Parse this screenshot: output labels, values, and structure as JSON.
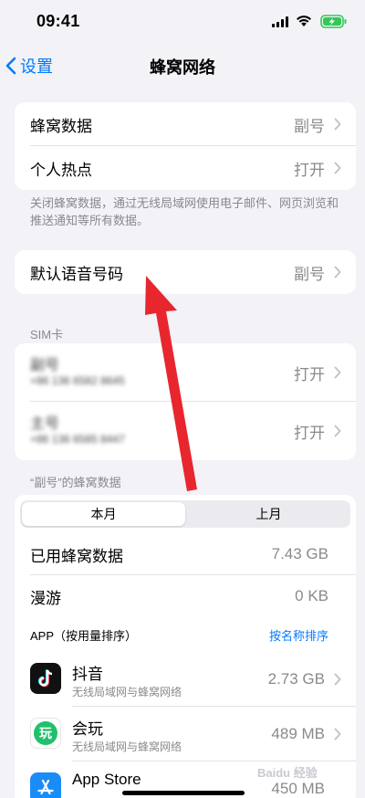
{
  "status": {
    "time": "09:41"
  },
  "nav": {
    "back_label": "设置",
    "title": "蜂窝网络"
  },
  "group1": {
    "rows": [
      {
        "label": "蜂窝数据",
        "value": "副号"
      },
      {
        "label": "个人热点",
        "value": "打开"
      }
    ],
    "footer": "关闭蜂窝数据，通过无线局域网使用电子邮件、网页浏览和推送通知等所有数据。"
  },
  "voice": {
    "label": "默认语音号码",
    "value": "副号"
  },
  "sim": {
    "header": "SIM卡",
    "rows": [
      {
        "name": "副号",
        "number": "+86 136 6582 8645",
        "value": "打开"
      },
      {
        "name": "主号",
        "number": "+86 136 6585 8447",
        "value": "打开"
      }
    ]
  },
  "usage": {
    "header": "“副号”的蜂窝数据",
    "tabs": [
      "本月",
      "上月"
    ],
    "rows": [
      {
        "label": "已用蜂窝数据",
        "value": "7.43 GB"
      },
      {
        "label": "漫游",
        "value": "0 KB"
      }
    ],
    "app_header": "APP（按用量排序）",
    "sort_label": "按名称排序",
    "apps": [
      {
        "name": "抖音",
        "sub": "无线局域网与蜂窝网络",
        "value": "2.73 GB"
      },
      {
        "name": "会玩",
        "sub": "无线局域网与蜂窝网络",
        "value": "489 MB"
      },
      {
        "name": "App Store",
        "sub": "",
        "value": "450 MB"
      }
    ]
  },
  "icons": {
    "douyin": "tiktok-icon",
    "huiwan": "huiwan-icon",
    "appstore": "app-store-icon",
    "huiwan_glyph": "玩"
  },
  "watermark": "Baidu 经验",
  "colors": {
    "accent": "#007aff",
    "arrow": "#e8262e",
    "battery": "#34c759"
  }
}
